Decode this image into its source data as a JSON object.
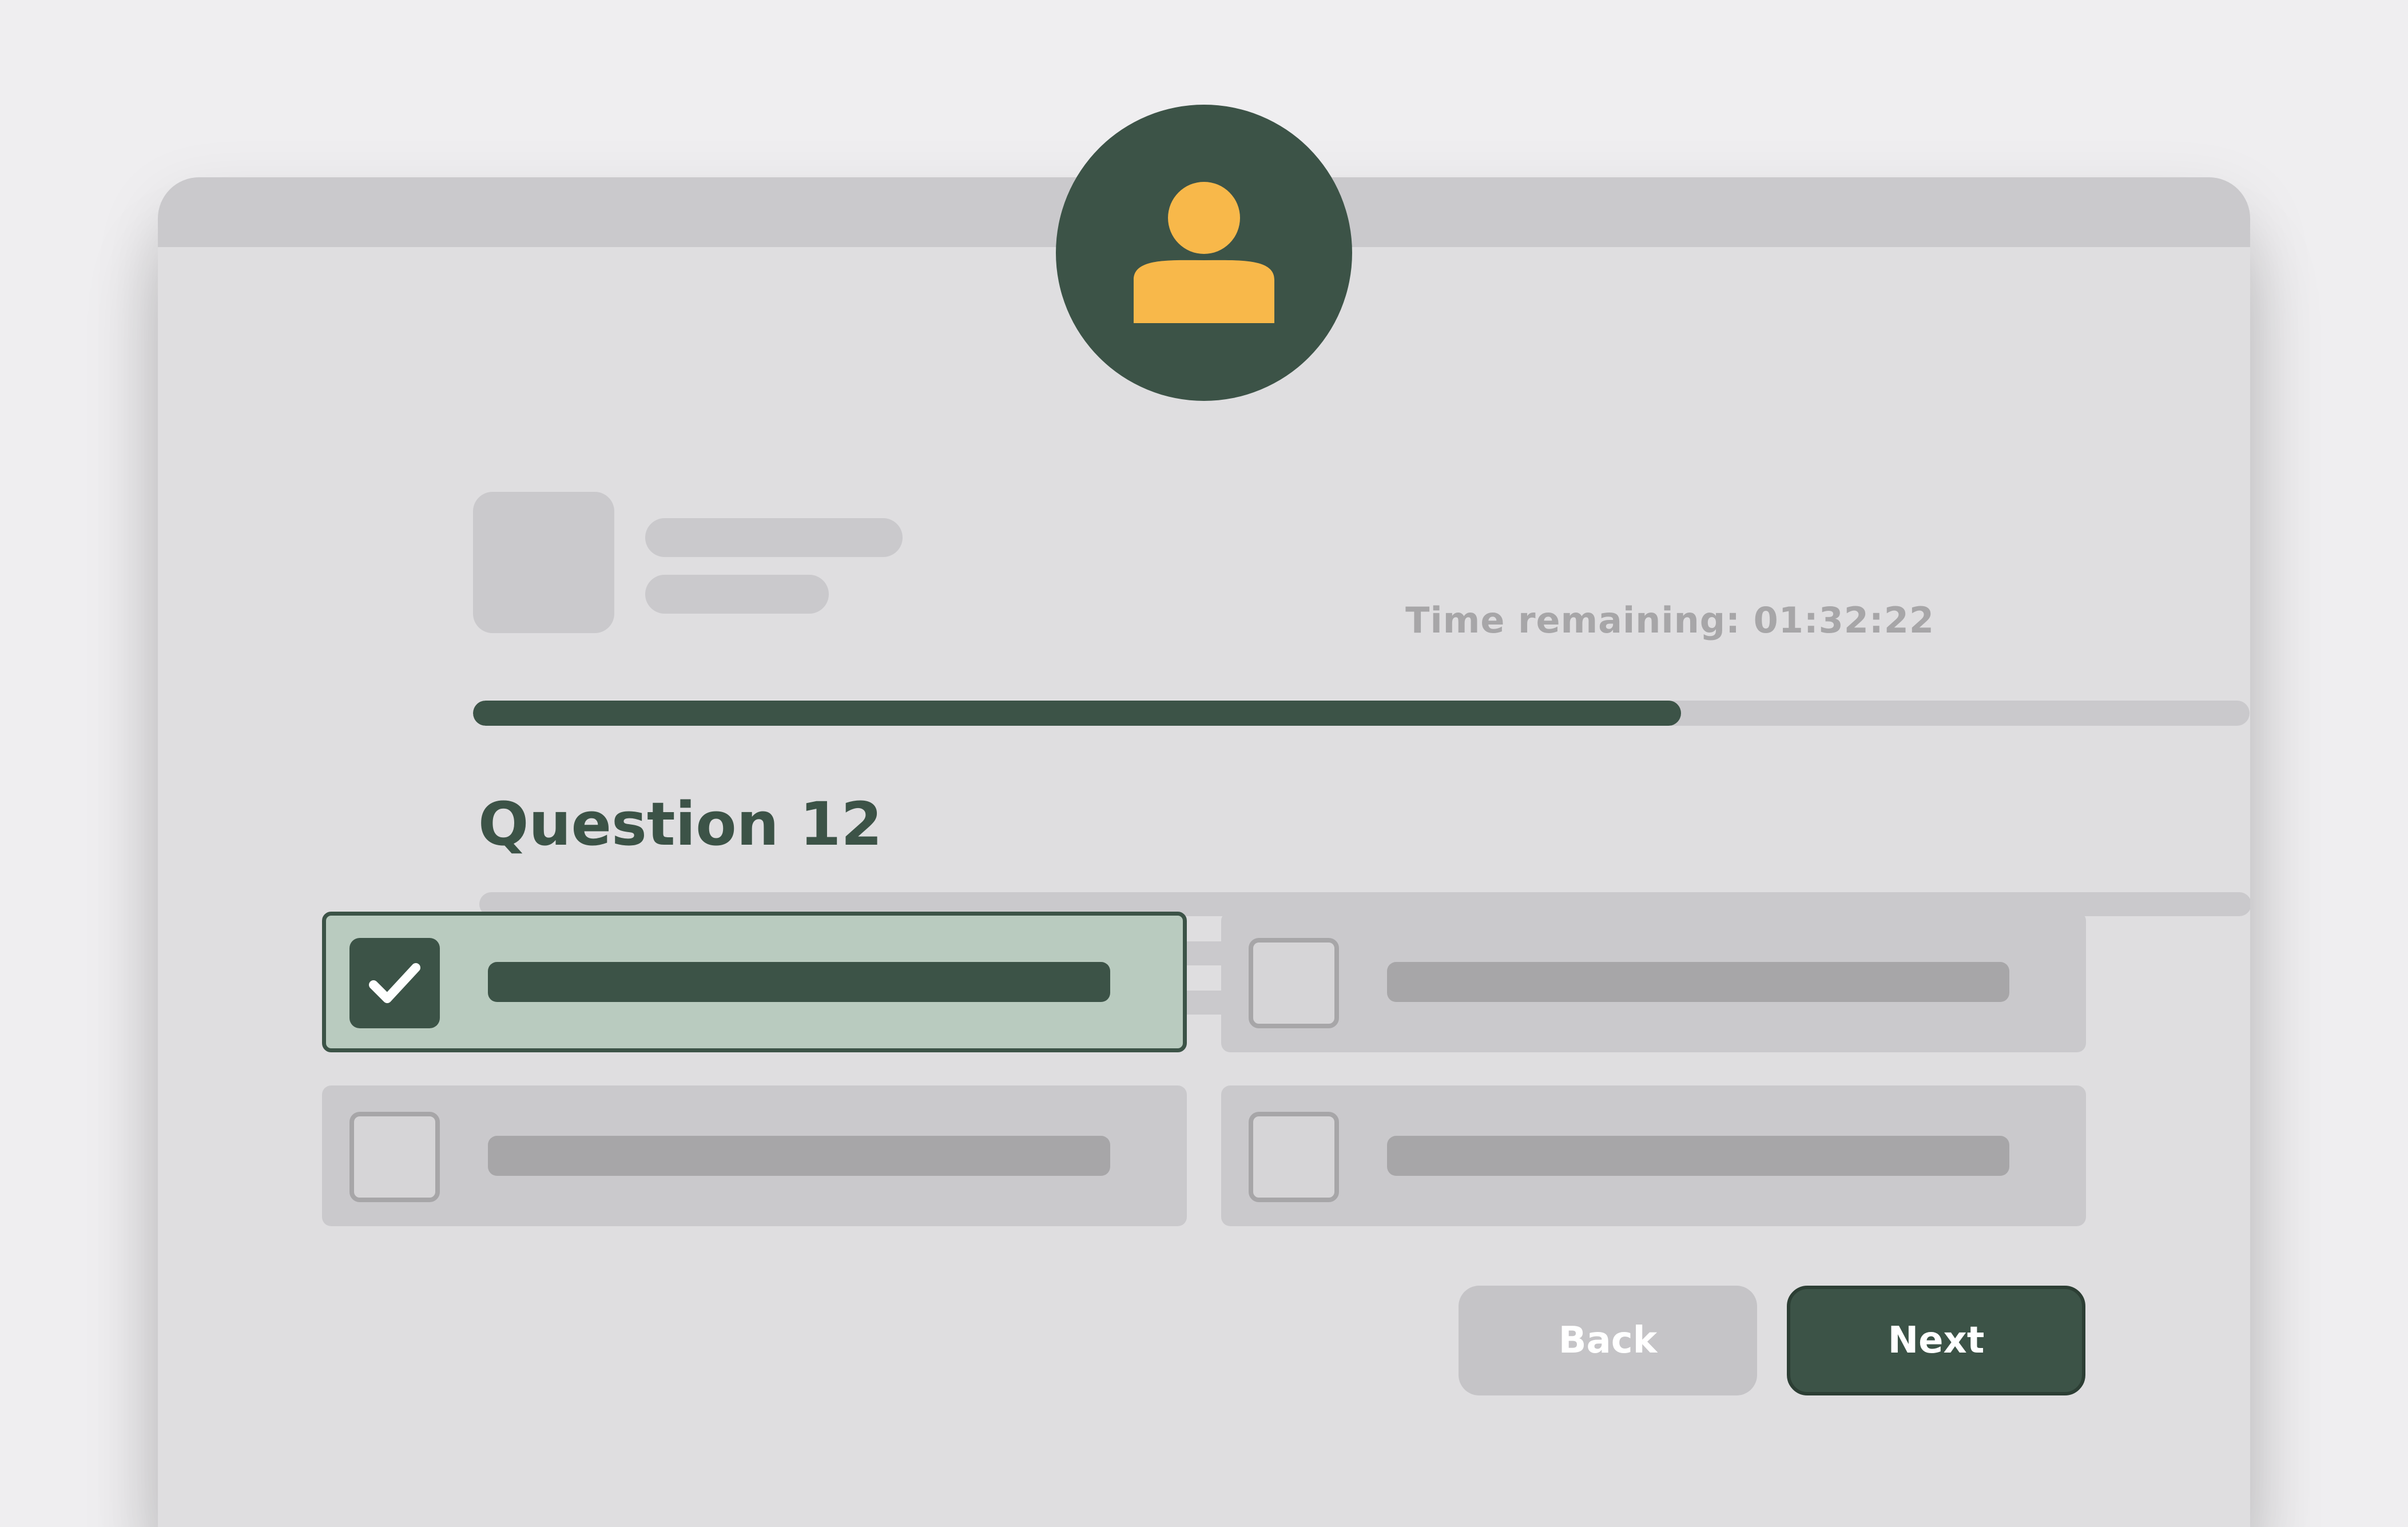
{
  "colors": {
    "accent": "#3c5347",
    "avatar_figure": "#f8b84a",
    "selected_option_bg": "#b9cbbf",
    "placeholder": "#cac9cc",
    "page_bg": "#efeef0"
  },
  "header": {
    "avatar_icon": "user-icon",
    "timer_text": "Time remaining: 01:32:22"
  },
  "progress": {
    "fraction": 0.68
  },
  "question": {
    "title": "Question 12"
  },
  "options": [
    {
      "selected": true,
      "icon": "checkmark-icon"
    },
    {
      "selected": false
    },
    {
      "selected": false
    },
    {
      "selected": false
    }
  ],
  "buttons": {
    "back_label": "Back",
    "next_label": "Next"
  }
}
